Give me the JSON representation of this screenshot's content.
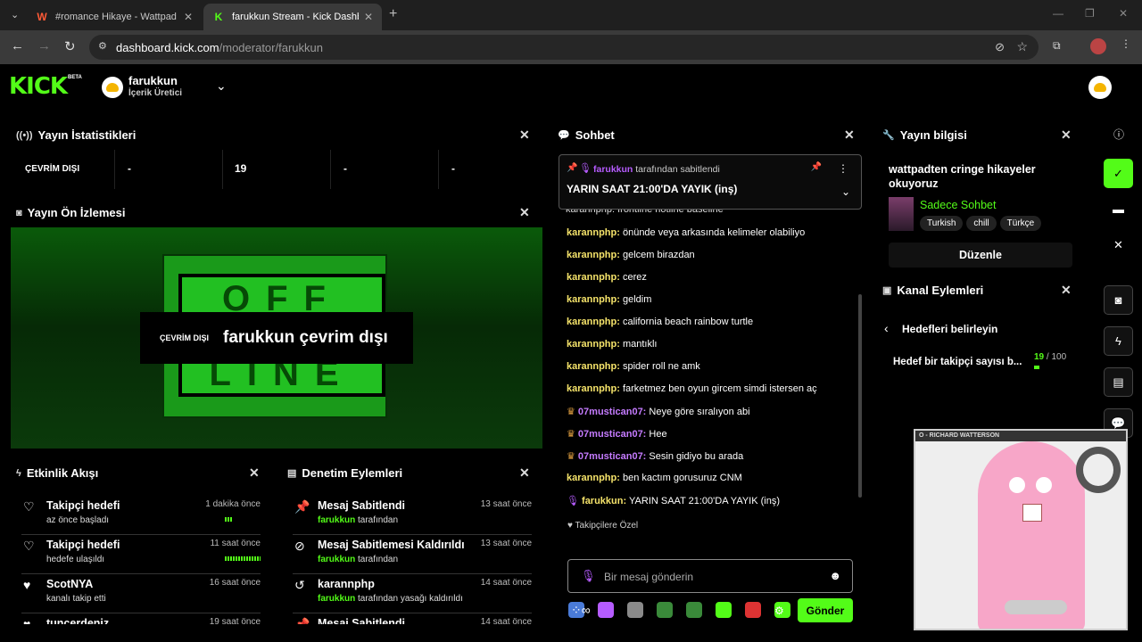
{
  "browser": {
    "tabs": [
      {
        "title": "#romance Hikaye - Wattpad",
        "favicon": "W"
      },
      {
        "title": "farukkun Stream - Kick Dashbo",
        "favicon": "K"
      }
    ],
    "url_host": "dashboard.kick.com",
    "url_path": "/moderator/farukkun"
  },
  "header": {
    "logo": "KICK",
    "beta": "BETA",
    "user": "farukkun",
    "role": "İçerik Üretici"
  },
  "stats": {
    "title": "Yayın İstatistikleri",
    "status": "ÇEVRİM DIŞI",
    "v1": "-",
    "v2": "19",
    "v3": "-",
    "v4": "-"
  },
  "preview": {
    "title": "Yayın Ön İzlemesi",
    "badge": "ÇEVRİM DIŞI",
    "message": "farukkun çevrim dışı",
    "offline_top": "OFF",
    "offline_bottom": "LINE"
  },
  "activity": {
    "title": "Etkinlik Akışı",
    "rows": [
      {
        "title": "Takipçi hedefi",
        "sub": "az önce başladı",
        "time": "1 dakika önce",
        "icon": "heart-outline"
      },
      {
        "title": "Takipçi hedefi",
        "sub": "hedefe ulaşıldı",
        "time": "11 saat önce",
        "icon": "heart-outline"
      },
      {
        "title": "ScotNYA",
        "sub": "kanalı takip etti",
        "time": "16 saat önce",
        "icon": "heart"
      },
      {
        "title": "tuncerdeniz",
        "sub": "",
        "time": "19 saat önce",
        "icon": "heart"
      }
    ]
  },
  "moderation": {
    "title": "Denetim Eylemleri",
    "rows": [
      {
        "title": "Mesaj Sabitlendi",
        "user": "farukkun",
        "suffix": " tarafından",
        "time": "13 saat önce"
      },
      {
        "title": "Mesaj Sabitlemesi Kaldırıldı",
        "user": "farukkun",
        "suffix": " tarafından",
        "time": "13 saat önce"
      },
      {
        "title": "karannphp",
        "user": "farukkun",
        "suffix": " tarafından yasağı kaldırıldı",
        "time": "14 saat önce"
      },
      {
        "title": "Mesaj Sabitlendi",
        "user": "",
        "suffix": "",
        "time": "14 saat önce"
      }
    ]
  },
  "chat": {
    "title": "Sohbet",
    "pinned_by": "farukkun",
    "pinned_suffix": " tarafından sabitlendi",
    "pinned_text": "YARIN SAAT 21:00'DA YAYIK (inş)",
    "partial": "karannphp: frontline hotline baseline",
    "messages": [
      {
        "user": "karannphp",
        "text": " önünde veya arkasında kelimeler olabiliyo",
        "color": "yellow"
      },
      {
        "user": "karannphp",
        "text": " gelcem birazdan",
        "color": "yellow"
      },
      {
        "user": "karannphp",
        "text": " cerez",
        "color": "yellow"
      },
      {
        "user": "karannphp",
        "text": " geldim",
        "color": "yellow"
      },
      {
        "user": "karannphp",
        "text": " california beach rainbow turtle",
        "color": "yellow"
      },
      {
        "user": "karannphp",
        "text": " mantıklı",
        "color": "yellow"
      },
      {
        "user": "karannphp",
        "text": " spider roll ne amk",
        "color": "yellow"
      },
      {
        "user": "karannphp",
        "text": " farketmez ben oyun gircem simdi istersen aç",
        "color": "yellow"
      },
      {
        "user": "07mustican07",
        "text": " Neye göre sıralıyon abi",
        "color": "purple"
      },
      {
        "user": "07mustican07",
        "text": " Hee",
        "color": "purple"
      },
      {
        "user": "07mustican07",
        "text": " Sesin gidiyo bu arada",
        "color": "purple"
      },
      {
        "user": "karannphp",
        "text": " ben kactım gorusuruz CNM",
        "color": "yellow"
      },
      {
        "user": "farukkun",
        "text": " YARIN SAAT 21:00'DA YAYIK (inş)",
        "color": "yellow"
      }
    ],
    "followers_only": "Takipçilere Özel",
    "input_placeholder": "Bir mesaj gönderin",
    "send": "Gönder"
  },
  "stream_info": {
    "title": "Yayın bilgisi",
    "stream_title": "wattpadten cringe hikayeler okuyoruz",
    "category": "Sadece Sohbet",
    "tags": [
      "Turkish",
      "chill",
      "Türkçe"
    ],
    "edit": "Düzenle"
  },
  "channel_actions": {
    "title": "Kanal Eylemleri",
    "back_label": "Hedefleri belirleyin",
    "goal_label": "Hedef bir takipçi sayısı b...",
    "goal_current": "19",
    "goal_sep": " / ",
    "goal_target": "100",
    "goal_progress": 0.19
  },
  "overlay": {
    "caption": "O - RICHARD WATTERSON"
  }
}
